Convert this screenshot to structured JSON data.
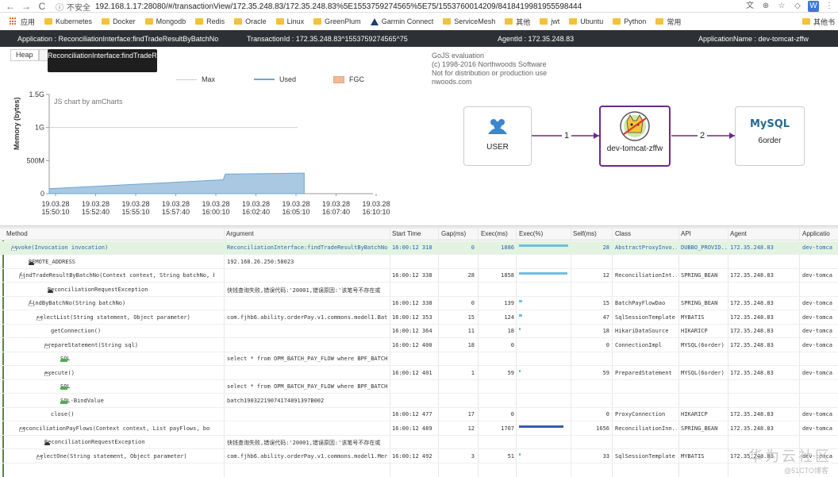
{
  "browser": {
    "insecure_label": "不安全",
    "url": "192.168.1.17:28080/#/transactionView/172.35.248.83/172.35.248.83%5E1553759274565%5E75/1553760014209/8418419981955598444",
    "bookmarks": [
      "应用",
      "Kubernetes",
      "Docker",
      "Mongodb",
      "Redis",
      "Oracle",
      "Linux",
      "GreenPlum",
      "Garmin Connect",
      "ServiceMesh",
      "其他",
      "jwt",
      "Ubuntu",
      "Python",
      "常用"
    ],
    "other_bookmarks": "其他书"
  },
  "infobar": {
    "application": "Application : ReconciliationInterface:findTradeResultByBatchNo",
    "transaction": "TransactionId : 172.35.248.83^1553759274565^75",
    "agent": "AgentId : 172.35.248.83",
    "appname": "ApplicationName : dev-tomcat-zffw"
  },
  "tabs": {
    "heap": "Heap"
  },
  "tooltip": "ReconciliationInterface:findTradeResultByBatchNo",
  "chart_data": {
    "type": "area",
    "ylabel": "Memory (bytes)",
    "credit": "JS chart by amCharts",
    "legend": [
      "Max",
      "Used",
      "FGC"
    ],
    "yticks": [
      "1.5G",
      "1G",
      "500M",
      "0"
    ],
    "xticks": [
      [
        "19.03.28",
        "15:50:10"
      ],
      [
        "19.03.28",
        "15:52:40"
      ],
      [
        "19.03.28",
        "15:55:10"
      ],
      [
        "19.03.28",
        "15:57:40"
      ],
      [
        "19.03.28",
        "16:00:10"
      ],
      [
        "19.03.28",
        "16:02:40"
      ],
      [
        "19.03.28",
        "16:05:10"
      ],
      [
        "19.03.28",
        "16:07:40"
      ],
      [
        "19.03.28",
        "16:10:10"
      ]
    ],
    "max": 1000,
    "used": [
      {
        "t": 0,
        "v": 75
      },
      {
        "t": 4.3,
        "v": 210
      },
      {
        "t": 4.35,
        "v": 295
      },
      {
        "t": 6.3,
        "v": 310
      }
    ]
  },
  "gojs": [
    "GoJS evaluation",
    "(c) 1998-2016 Northwoods Software",
    "Not for distribution or production use",
    "nwoods.com"
  ],
  "diagram": {
    "user": "USER",
    "app": "dev-tomcat-zffw",
    "db": "6order",
    "db_logo": "MySQL",
    "edge1": "1",
    "edge2": "2"
  },
  "columns": [
    "Method",
    "Argument",
    "Start Time",
    "Gap(ms)",
    "Exec(ms)",
    "Exec(%)",
    "Self(ms)",
    "Class",
    "API",
    "Agent",
    "Applicatio"
  ],
  "rows": [
    {
      "method": "invoke(Invocation invocation)",
      "arg": "ReconciliationInterface:findTradeResultByBatchNo",
      "start": "16:00:12 318",
      "gap": "0",
      "exec": "1886",
      "pct": 1.0,
      "self": "28",
      "cls": "AbstractProxyInvo...",
      "api": "DUBBO_PROVID...",
      "agent": "172.35.248.83",
      "app": "dev-tomca"
    },
    {
      "method": "REMOTE_ADDRESS",
      "arg": "192.168.26.250:58023",
      "start": "",
      "gap": "",
      "exec": "",
      "pct": 0,
      "self": "",
      "cls": "",
      "api": "",
      "agent": "",
      "app": ""
    },
    {
      "method": "findTradeResultByBatchNo(Context context, String batchNo, b",
      "arg": "",
      "start": "16:00:12 338",
      "gap": "28",
      "exec": "1858",
      "pct": 0.98,
      "self": "12",
      "cls": "ReconciliationInt...",
      "api": "SPRING_BEAN",
      "agent": "172.35.248.83",
      "app": "dev-tomca"
    },
    {
      "method": "ReconciliationRequestException",
      "arg": "快钱查询失败,错误代码:'20001,错误原因:'该笔号不存在或",
      "start": "",
      "gap": "",
      "exec": "",
      "pct": 0,
      "self": "",
      "cls": "",
      "api": "",
      "agent": "",
      "app": ""
    },
    {
      "method": "findByBatchNo(String batchNo)",
      "arg": "",
      "start": "16:00:12 338",
      "gap": "0",
      "exec": "139",
      "pct": 0.06,
      "self": "15",
      "cls": "BatchPayFlowDao",
      "api": "SPRING_BEAN",
      "agent": "172.35.248.83",
      "app": "dev-tomca"
    },
    {
      "method": "selectList(String statement, Object parameter)",
      "arg": "com.fjhb6.ability.orderPay.v1.commons.model1.Batch",
      "start": "16:00:12 353",
      "gap": "15",
      "exec": "124",
      "pct": 0.06,
      "self": "47",
      "cls": "SqlSessionTemplate",
      "api": "MYBATIS",
      "agent": "172.35.248.83",
      "app": "dev-tomca"
    },
    {
      "method": "getConnection()",
      "arg": "",
      "start": "16:00:12 364",
      "gap": "11",
      "exec": "18",
      "pct": 0.01,
      "self": "18",
      "cls": "HikariDataSource",
      "api": "HIKARICP",
      "agent": "172.35.248.83",
      "app": "dev-tomca"
    },
    {
      "method": "prepareStatement(String sql)",
      "arg": "",
      "start": "16:00:12 400",
      "gap": "18",
      "exec": "0",
      "pct": 0,
      "self": "0",
      "cls": "ConnectionImpl",
      "api": "MYSQL(6order)",
      "agent": "172.35.248.83",
      "app": "dev-tomca"
    },
    {
      "method": "SQL",
      "arg": "select * from OPM_BATCH_PAY_FLOW where BPF_BATCH_",
      "start": "",
      "gap": "",
      "exec": "",
      "pct": 0,
      "self": "",
      "cls": "",
      "api": "",
      "agent": "",
      "app": ""
    },
    {
      "method": "execute()",
      "arg": "",
      "start": "16:00:12 401",
      "gap": "1",
      "exec": "59",
      "pct": 0.03,
      "self": "59",
      "cls": "PreparedStatement",
      "api": "MYSQL(6order)",
      "agent": "172.35.248.83",
      "app": "dev-tomca"
    },
    {
      "method": "SQL",
      "arg": "select * from OPM_BATCH_PAY_FLOW where BPF_BATCH_",
      "start": "",
      "gap": "",
      "exec": "",
      "pct": 0,
      "self": "",
      "cls": "",
      "api": "",
      "agent": "",
      "app": ""
    },
    {
      "method": "SQL-BindValue",
      "arg": "batch19032219074174891397B002",
      "start": "",
      "gap": "",
      "exec": "",
      "pct": 0,
      "self": "",
      "cls": "",
      "api": "",
      "agent": "",
      "app": ""
    },
    {
      "method": "close()",
      "arg": "",
      "start": "16:00:12 477",
      "gap": "17",
      "exec": "0",
      "pct": 0,
      "self": "0",
      "cls": "ProxyConnection",
      "api": "HIKARICP",
      "agent": "172.35.248.83",
      "app": "dev-tomca"
    },
    {
      "method": "reconciliationPayFlows(Context context, List payFlows, bo",
      "arg": "",
      "start": "16:00:12 489",
      "gap": "12",
      "exec": "1707",
      "pct": 0.9,
      "self": "1656",
      "cls": "ReconciliationInn...",
      "api": "SPRING_BEAN",
      "agent": "172.35.248.83",
      "app": "dev-tomca"
    },
    {
      "method": "ReconciliationRequestException",
      "arg": "快钱查询失败,错误代码:'20001,错误原因:'该笔号不存在或",
      "start": "",
      "gap": "",
      "exec": "",
      "pct": 0,
      "self": "",
      "cls": "",
      "api": "",
      "agent": "",
      "app": ""
    },
    {
      "method": "selectOne(String statement, Object parameter)",
      "arg": "com.fjhb6.ability.orderPay.v1.commons.model1.Merch",
      "start": "16:00:12 492",
      "gap": "3",
      "exec": "51",
      "pct": 0.02,
      "self": "33",
      "cls": "SqlSessionTemplate",
      "api": "MYBATIS",
      "agent": "172.35.248.83",
      "app": "dev-tomca"
    }
  ],
  "watermark": "华为云社区",
  "watermark2": "@51CTO博客"
}
